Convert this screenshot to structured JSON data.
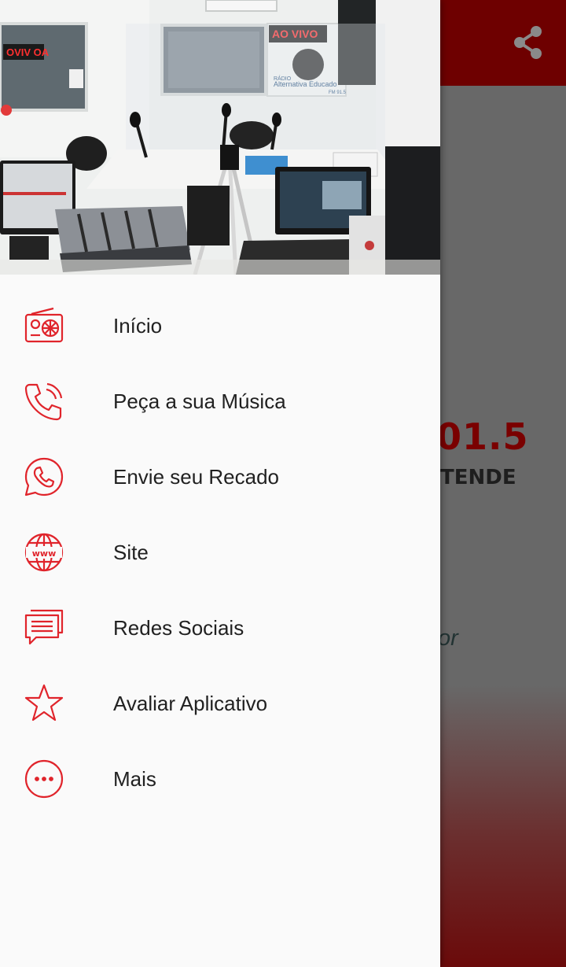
{
  "background": {
    "toolbar_color": "#6e0000",
    "share_icon": "share-icon",
    "frequency_text": "01.5",
    "slogan_text": "TENDE",
    "fragment_text": "or"
  },
  "drawer": {
    "header_photo": {
      "led_sign": "AO VIVO",
      "led_sign_mirror": "OVIV OA",
      "poster_line1": "RÁDIO",
      "poster_line2": "Alternativa Educado",
      "poster_line3": "FM 91.5"
    },
    "accent_color": "#e0242b",
    "items": [
      {
        "label": "Início",
        "icon": "radio-icon"
      },
      {
        "label": "Peça a sua Música",
        "icon": "phone-icon"
      },
      {
        "label": "Envie seu Recado",
        "icon": "whatsapp-icon"
      },
      {
        "label": "Site",
        "icon": "globe-www-icon"
      },
      {
        "label": "Redes Sociais",
        "icon": "chat-icon"
      },
      {
        "label": "Avaliar Aplicativo",
        "icon": "star-icon"
      },
      {
        "label": "Mais",
        "icon": "more-icon"
      }
    ]
  }
}
